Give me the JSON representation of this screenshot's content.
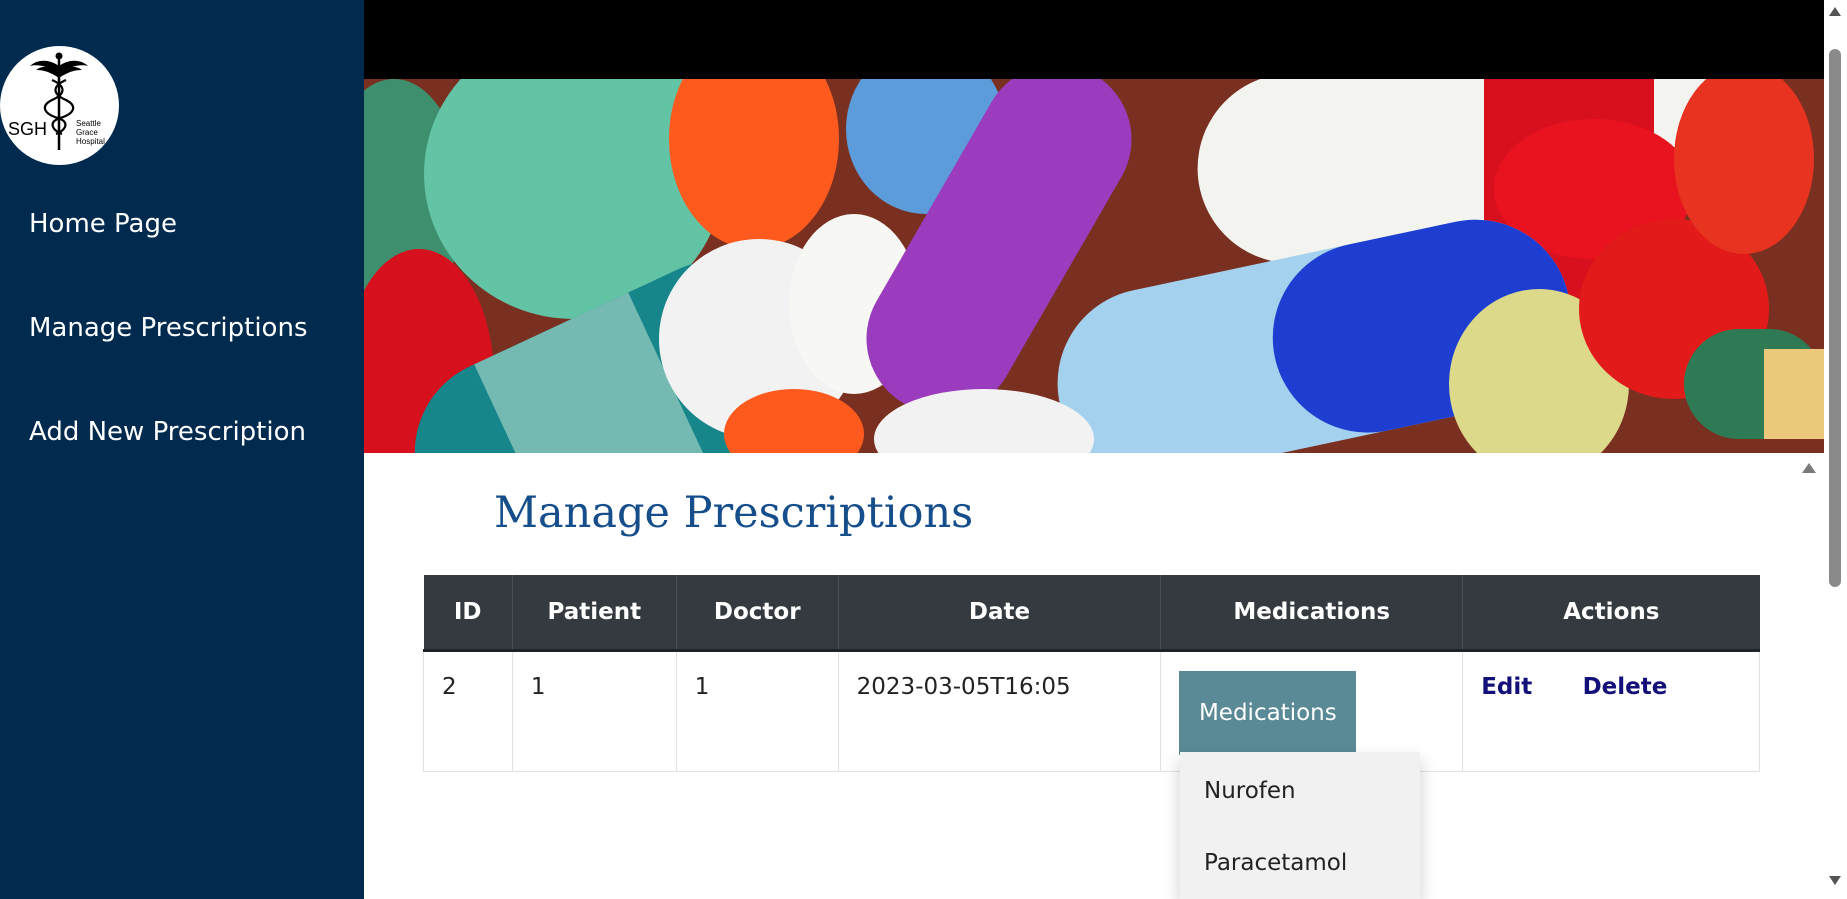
{
  "sidebar": {
    "logo": {
      "initials": "SGH",
      "name_lines": [
        "Seattle",
        "Grace",
        "Hospital"
      ],
      "icon": "caduceus-icon"
    },
    "nav": [
      {
        "label": "Home Page"
      },
      {
        "label": "Manage Prescriptions"
      },
      {
        "label": "Add New Prescription"
      }
    ]
  },
  "hero": {
    "image": "colorful-pills-banner"
  },
  "page": {
    "title": "Manage Prescriptions"
  },
  "table": {
    "headers": [
      "ID",
      "Patient",
      "Doctor",
      "Date",
      "Medications",
      "Actions"
    ],
    "rows": [
      {
        "id": "2",
        "patient": "1",
        "doctor": "1",
        "date": "2023-03-05T16:05",
        "medications_button": "Medications",
        "edit": "Edit",
        "delete": "Delete"
      }
    ]
  },
  "medications_dropdown": {
    "items": [
      "Nurofen",
      "Paracetamol"
    ]
  },
  "colors": {
    "sidebar_bg": "#002b4f",
    "title": "#154e8b",
    "table_header_bg": "#343a40",
    "med_button_bg": "#5a8a96",
    "action_link": "#14107a"
  }
}
